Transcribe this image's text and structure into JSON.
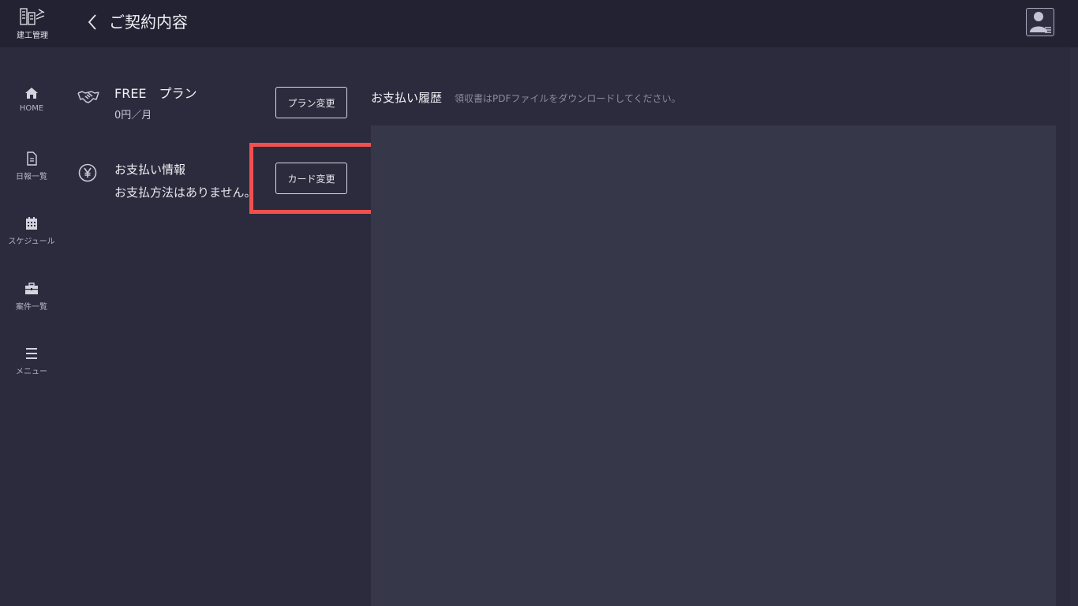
{
  "header": {
    "logo_text": "建工管理",
    "back_icon": "chevron-left-icon",
    "title": "ご契約内容",
    "avatar_icon": "user-menu-icon"
  },
  "sidebar": {
    "items": [
      {
        "icon": "home-icon",
        "label": "HOME"
      },
      {
        "icon": "document-icon",
        "label": "日報一覧"
      },
      {
        "icon": "calendar-icon",
        "label": "スケジュール"
      },
      {
        "icon": "briefcase-icon",
        "label": "案件一覧"
      },
      {
        "icon": "hamburger-menu-icon",
        "label": "メニュー"
      }
    ]
  },
  "plan": {
    "icon": "handshake-icon",
    "name": "FREE　プラン",
    "price": "0円／月",
    "change_button": "プラン変更"
  },
  "payment": {
    "icon": "yen-icon",
    "title": "お支払い情報",
    "description": "お支払方法はありません。",
    "change_button": "カード変更"
  },
  "history": {
    "title": "お支払い履歴",
    "note": "領収書はPDFファイルをダウンロードしてください。"
  },
  "colors": {
    "background": "#2b2b3d",
    "topbar": "#222233",
    "panel": "#363849",
    "highlight": "#f2504f"
  }
}
